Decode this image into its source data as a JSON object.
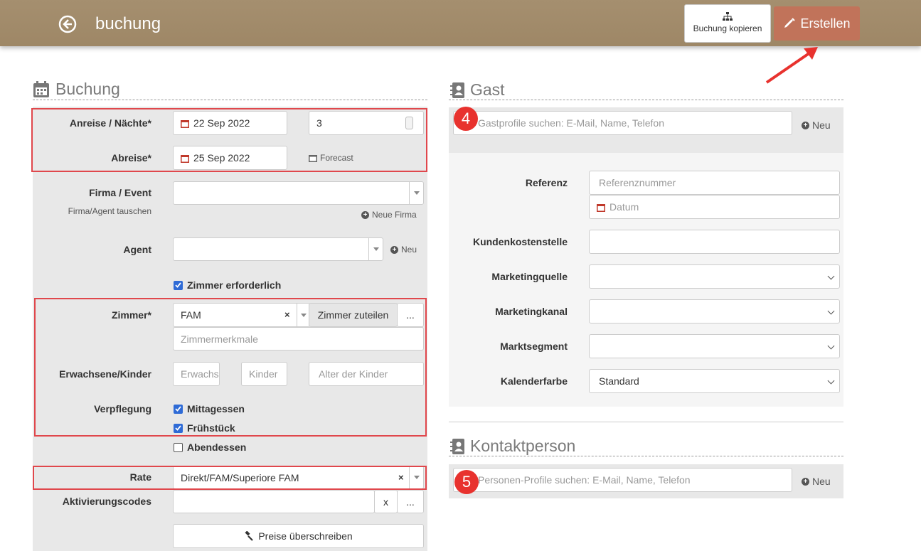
{
  "header": {
    "title": "buchung",
    "copy_button": "Buchung kopieren",
    "create_button": "Erstellen"
  },
  "buchung": {
    "heading": "Buchung",
    "arrival_label": "Anreise / Nächte*",
    "arrival_date": "22 Sep 2022",
    "nights": "3",
    "departure_label": "Abreise*",
    "departure_date": "25 Sep 2022",
    "forecast_link": "Forecast",
    "company_label": "Firma / Event",
    "swap_agent": "Firma/Agent tauschen",
    "new_company": "Neue Firma",
    "agent_label": "Agent",
    "agent_new": "Neu",
    "room_required": "Zimmer erforderlich",
    "room_label": "Zimmer*",
    "room_value": "FAM",
    "assign_room": "Zimmer zuteilen",
    "more_btn": "...",
    "room_features_placeholder": "Zimmermerkmale",
    "adults_children_label": "Erwachsene/Kinder",
    "adults_placeholder": "Erwachsene",
    "children_placeholder": "Kinder",
    "children_age_placeholder": "Alter der Kinder",
    "meals_label": "Verpflegung",
    "meal_lunch": "Mittagessen",
    "meal_breakfast": "Frühstück",
    "meal_dinner": "Abendessen",
    "rate_label": "Rate",
    "rate_value": "Direkt/FAM/Superiore FAM",
    "activation_label": "Aktivierungscodes",
    "clear_btn": "x",
    "override_prices": "Preise überschreiben"
  },
  "gast": {
    "heading": "Gast",
    "search_placeholder": "Gastprofile suchen: E-Mail, Name, Telefon",
    "new_link": "Neu",
    "reference_label": "Referenz",
    "reference_placeholder": "Referenznummer",
    "date_placeholder": "Datum",
    "cost_center_label": "Kundenkostenstelle",
    "marketing_source_label": "Marketingquelle",
    "marketing_channel_label": "Marketingkanal",
    "market_segment_label": "Marktsegment",
    "calendar_color_label": "Kalenderfarbe",
    "calendar_color_value": "Standard"
  },
  "kontakt": {
    "heading": "Kontaktperson",
    "search_placeholder": "Personen-Profile suchen: E-Mail, Name, Telefon",
    "new_link": "Neu"
  },
  "badges": {
    "four": "4",
    "five": "5"
  },
  "colors": {
    "header": "#a58f6f",
    "create": "#c1735a",
    "highlight": "#e0474c",
    "checkbox": "#2f6bd6"
  }
}
